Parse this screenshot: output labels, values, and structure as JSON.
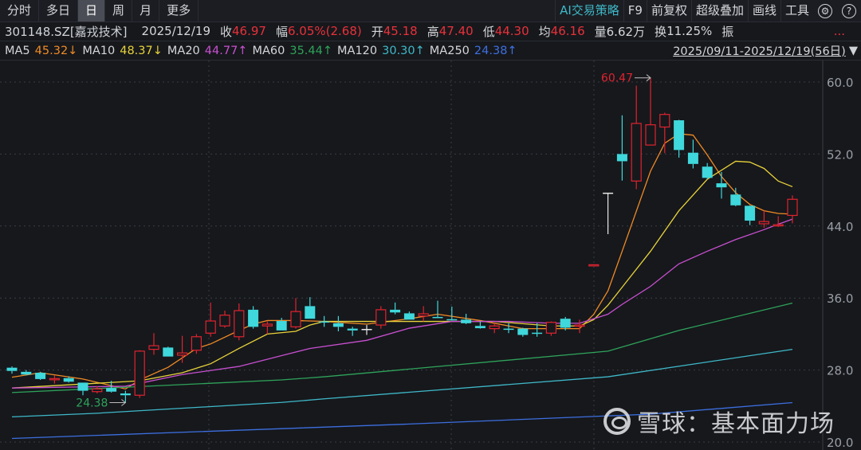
{
  "tabs": [
    {
      "label": "分时"
    },
    {
      "label": "多日"
    },
    {
      "label": "日",
      "selected": true
    },
    {
      "label": "周"
    },
    {
      "label": "月"
    },
    {
      "label": "更多"
    }
  ],
  "tools": {
    "ai": "AI交易策略",
    "f9": "F9",
    "adjust": "前复权",
    "overlay": "超级叠加",
    "draw": "画线",
    "tools": "工具",
    "settings_icon": "gear-icon",
    "help_icon": "question-icon"
  },
  "info": {
    "code": "301148.SZ[嘉戎技术]",
    "date": "2025/12/19",
    "close_label": "收",
    "close": "46.97",
    "change_label": "幅",
    "change": "6.05%(2.68)",
    "open_label": "开",
    "open": "45.18",
    "high_label": "高",
    "high": "47.40",
    "low_label": "低",
    "low": "44.30",
    "avg_label": "均",
    "avg": "46.16",
    "volume_label": "量",
    "volume": "6.62万",
    "turnover_label": "换",
    "turnover": "11.25%",
    "amplitude_label": "振",
    "more": "..."
  },
  "ma_legend": [
    {
      "name": "MA5",
      "value": "45.32↓",
      "color": "#f08a24"
    },
    {
      "name": "MA10",
      "value": "48.37↓",
      "color": "#e8d23a"
    },
    {
      "name": "MA20",
      "value": "44.77↑",
      "color": "#c94fd0"
    },
    {
      "name": "MA60",
      "value": "35.44↑",
      "color": "#2fa35a"
    },
    {
      "name": "MA120",
      "value": "30.30↑",
      "color": "#3fb8c8"
    },
    {
      "name": "MA250",
      "value": "24.38↑",
      "color": "#3d6fe0"
    }
  ],
  "range": "2025/09/11-2025/12/19(56日)",
  "watermark": "雪球：基本面力场",
  "chart_data": {
    "type": "candlestick",
    "colors": {
      "up": "#e0232f",
      "down": "#3fd8dc",
      "flat": "#e8e8e8"
    },
    "ylim": [
      20,
      60
    ],
    "yticks": [
      {
        "v": 60,
        "label": "60.0"
      },
      {
        "v": 52,
        "label": "52.0"
      },
      {
        "v": 44,
        "label": "44.0"
      },
      {
        "v": 36,
        "label": "36.0"
      },
      {
        "v": 28,
        "label": "28.0"
      },
      {
        "v": 20,
        "label": "20.0"
      }
    ],
    "ohlc": [
      [
        28.26,
        28.4,
        27.6,
        27.9
      ],
      [
        27.8,
        28.0,
        27.4,
        27.5
      ],
      [
        27.7,
        27.8,
        26.9,
        27.0
      ],
      [
        26.95,
        27.4,
        26.5,
        27.05
      ],
      [
        27.1,
        27.3,
        26.6,
        26.7
      ],
      [
        26.6,
        26.6,
        25.2,
        25.7
      ],
      [
        25.6,
        26.2,
        25.4,
        25.9
      ],
      [
        26.0,
        26.8,
        25.5,
        25.6
      ],
      [
        25.4,
        25.7,
        24.38,
        25.2
      ],
      [
        25.2,
        30.2,
        24.9,
        30.1
      ],
      [
        30.3,
        32.1,
        29.7,
        30.7
      ],
      [
        30.5,
        30.6,
        29.5,
        29.5
      ],
      [
        29.65,
        31.8,
        28.8,
        29.9
      ],
      [
        30.2,
        32.0,
        29.8,
        31.7
      ],
      [
        32.1,
        35.5,
        31.7,
        33.45
      ],
      [
        32.9,
        34.6,
        32.7,
        34.1
      ],
      [
        31.7,
        35.4,
        31.3,
        34.6
      ],
      [
        34.7,
        35.1,
        32.6,
        32.8
      ],
      [
        32.9,
        33.4,
        32.0,
        33.1
      ],
      [
        33.45,
        33.8,
        32.4,
        32.4
      ],
      [
        32.8,
        36.0,
        32.6,
        34.5
      ],
      [
        35.1,
        36.1,
        33.7,
        33.7
      ],
      [
        33.4,
        34.0,
        32.8,
        33.3
      ],
      [
        33.2,
        34.0,
        32.3,
        32.8
      ],
      [
        32.6,
        32.8,
        31.8,
        32.4
      ],
      [
        32.5,
        33.0,
        31.9,
        32.5
      ],
      [
        33.0,
        35.1,
        32.6,
        34.7
      ],
      [
        34.7,
        35.5,
        34.2,
        34.4
      ],
      [
        34.3,
        34.5,
        33.6,
        33.6
      ],
      [
        34.0,
        35.1,
        33.4,
        34.25
      ],
      [
        33.9,
        35.7,
        33.8,
        33.8
      ],
      [
        33.65,
        35.05,
        33.5,
        33.55
      ],
      [
        33.6,
        34.25,
        33.1,
        33.2
      ],
      [
        32.9,
        33.4,
        32.6,
        32.65
      ],
      [
        32.6,
        33.2,
        32.1,
        32.9
      ],
      [
        32.6,
        33.2,
        32.1,
        32.5
      ],
      [
        32.6,
        32.7,
        31.7,
        31.9
      ],
      [
        32.15,
        33.2,
        31.7,
        32.05
      ],
      [
        32.1,
        33.4,
        31.8,
        33.3
      ],
      [
        33.7,
        33.9,
        32.4,
        32.7
      ],
      [
        32.9,
        33.6,
        32.1,
        33.0
      ],
      [
        39.65,
        39.7,
        39.65,
        39.7
      ],
      [
        47.64,
        47.64,
        43.1,
        47.64
      ],
      [
        52.0,
        56.3,
        49.05,
        51.2
      ],
      [
        49.0,
        59.6,
        48.1,
        55.4
      ],
      [
        53.0,
        60.47,
        52.95,
        55.25
      ],
      [
        55.0,
        56.6,
        52.1,
        56.4
      ],
      [
        55.75,
        55.8,
        51.6,
        52.45
      ],
      [
        52.15,
        53.6,
        50.4,
        50.9
      ],
      [
        50.6,
        51.0,
        49.2,
        49.35
      ],
      [
        48.75,
        50.0,
        47.05,
        48.3
      ],
      [
        47.5,
        48.25,
        46.2,
        46.3
      ],
      [
        46.25,
        46.3,
        44.1,
        44.6
      ],
      [
        44.25,
        45.7,
        43.8,
        44.5
      ],
      [
        44.1,
        45.1,
        43.9,
        44.15
      ],
      [
        45.18,
        47.4,
        44.3,
        46.97
      ]
    ],
    "ma_lines": [
      {
        "name": "MA5",
        "color": "#f08a24",
        "points": [
          [
            0,
            27.2
          ],
          [
            2,
            27.7
          ],
          [
            5,
            27.0
          ],
          [
            8,
            25.9
          ],
          [
            9,
            26.9
          ],
          [
            11,
            28.3
          ],
          [
            13,
            30.4
          ],
          [
            14,
            30.9
          ],
          [
            16,
            32.4
          ],
          [
            17,
            33.1
          ],
          [
            18,
            33.5
          ],
          [
            20,
            33.5
          ],
          [
            22,
            33.4
          ],
          [
            25,
            33.1
          ],
          [
            28,
            33.7
          ],
          [
            30,
            34.2
          ],
          [
            33,
            33.5
          ],
          [
            36,
            32.6
          ],
          [
            40,
            32.6
          ],
          [
            41,
            34.2
          ],
          [
            42,
            36.8
          ],
          [
            43,
            41.2
          ],
          [
            45,
            50.1
          ],
          [
            46,
            53.2
          ],
          [
            47,
            54.25
          ],
          [
            48,
            54.1
          ],
          [
            49,
            51.9
          ],
          [
            50,
            49.5
          ],
          [
            51,
            47.7
          ],
          [
            52,
            46.4
          ],
          [
            53,
            45.7
          ],
          [
            54,
            45.4
          ],
          [
            55,
            45.32
          ]
        ]
      },
      {
        "name": "MA10",
        "color": "#e8d23a",
        "points": [
          [
            0,
            26.0
          ],
          [
            9,
            26.8
          ],
          [
            12,
            27.7
          ],
          [
            14,
            28.7
          ],
          [
            16,
            30.4
          ],
          [
            18,
            32.0
          ],
          [
            20,
            32.3
          ],
          [
            21,
            33.0
          ],
          [
            22,
            33.4
          ],
          [
            28,
            33.4
          ],
          [
            34,
            33.4
          ],
          [
            38,
            32.9
          ],
          [
            40,
            32.9
          ],
          [
            41,
            33.6
          ],
          [
            42,
            35.2
          ],
          [
            43,
            37.2
          ],
          [
            45,
            41.2
          ],
          [
            47,
            45.7
          ],
          [
            49,
            49.2
          ],
          [
            51,
            51.2
          ],
          [
            52,
            51.1
          ],
          [
            53,
            50.4
          ],
          [
            54,
            49.0
          ],
          [
            55,
            48.37
          ]
        ]
      },
      {
        "name": "MA20",
        "color": "#c94fd0",
        "points": [
          [
            0,
            26.0
          ],
          [
            8,
            26.2
          ],
          [
            12,
            27.5
          ],
          [
            16,
            28.4
          ],
          [
            19,
            29.6
          ],
          [
            21,
            30.4
          ],
          [
            25,
            31.3
          ],
          [
            28,
            32.65
          ],
          [
            31,
            33.4
          ],
          [
            35,
            33.4
          ],
          [
            38,
            33.2
          ],
          [
            40,
            33.2
          ],
          [
            42,
            34.2
          ],
          [
            43,
            35.3
          ],
          [
            45,
            37.3
          ],
          [
            47,
            39.8
          ],
          [
            49,
            41.2
          ],
          [
            51,
            42.5
          ],
          [
            53,
            43.6
          ],
          [
            54,
            44.2
          ],
          [
            55,
            44.77
          ]
        ]
      },
      {
        "name": "MA60",
        "color": "#2fa35a",
        "points": [
          [
            0,
            25.5
          ],
          [
            19,
            26.9
          ],
          [
            22,
            27.25
          ],
          [
            42,
            30.1
          ],
          [
            47,
            32.4
          ],
          [
            55,
            35.44
          ]
        ]
      },
      {
        "name": "MA120",
        "color": "#3fb8c8",
        "points": [
          [
            0,
            22.8
          ],
          [
            6,
            23.2
          ],
          [
            19,
            24.4
          ],
          [
            22,
            24.8
          ],
          [
            42,
            27.25
          ],
          [
            55,
            30.3
          ]
        ]
      },
      {
        "name": "MA250",
        "color": "#3d6fe0",
        "points": [
          [
            0,
            20.4
          ],
          [
            28,
            22.0
          ],
          [
            45,
            23.1
          ],
          [
            55,
            24.38
          ]
        ]
      }
    ],
    "annotations": [
      {
        "index": 45,
        "value": 60.47,
        "label": "60.47",
        "color": "#e0232f",
        "side": "left"
      },
      {
        "index": 8,
        "value": 24.38,
        "label": "24.38",
        "color": "#2fa35a",
        "side": "left"
      }
    ]
  }
}
